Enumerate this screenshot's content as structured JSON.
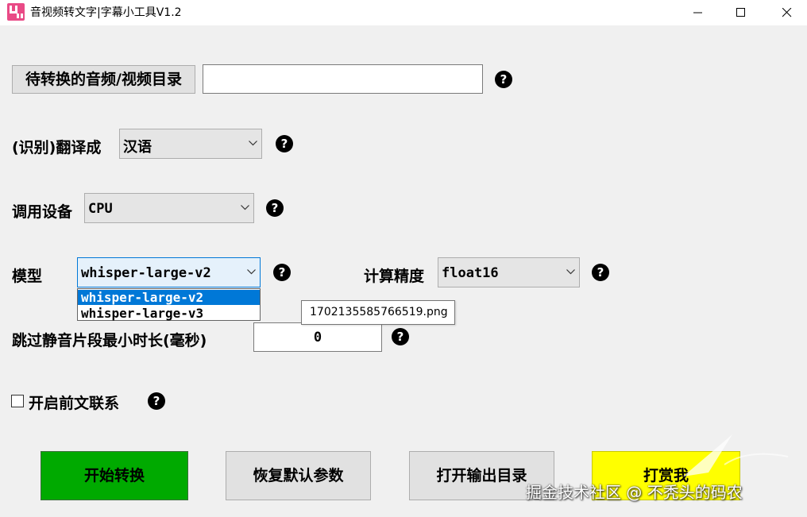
{
  "window": {
    "title": "音视频转文字|字幕小工具V1.2",
    "controls": [
      "minimize-icon",
      "maximize-icon",
      "close-icon"
    ]
  },
  "form": {
    "input_dir": {
      "button_label": "待转换的音频/视频目录",
      "value": ""
    },
    "translate": {
      "label": "(识别)翻译成",
      "selected": "汉语"
    },
    "device": {
      "label": "调用设备",
      "selected": "CPU"
    },
    "model": {
      "label": "模型",
      "selected": "whisper-large-v2",
      "options": [
        "whisper-large-v2",
        "whisper-large-v3"
      ]
    },
    "precision": {
      "label": "计算精度",
      "selected": "float16"
    },
    "min_silence": {
      "label": "跳过静音片段最小时长(毫秒)",
      "value": "0"
    },
    "context": {
      "label": "开启前文联系",
      "checked": false
    },
    "help_glyph": "?"
  },
  "tooltip": {
    "text": "1702135585766519.png"
  },
  "buttons": {
    "start": {
      "label": "开始转换",
      "color": "#00aa00"
    },
    "reset": {
      "label": "恢复默认参数",
      "color": "#e1e1e1"
    },
    "open_output": {
      "label": "打开输出目录",
      "color": "#e1e1e1"
    },
    "donate": {
      "label": "打赏我",
      "color": "#ffff00"
    }
  },
  "watermark": {
    "text": "掘金技术社区 @ 不秃头的码农"
  }
}
